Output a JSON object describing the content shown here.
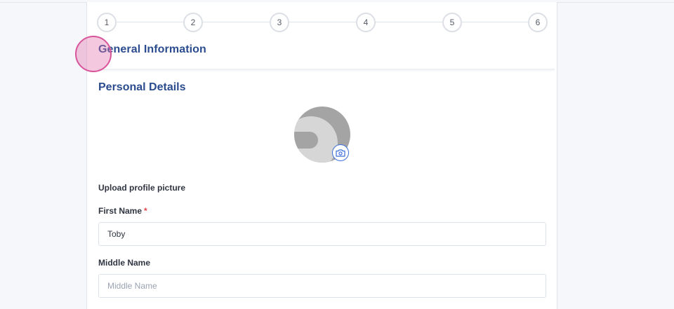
{
  "stepper": {
    "steps": [
      "1",
      "2",
      "3",
      "4",
      "5",
      "6"
    ]
  },
  "section": {
    "title": "General Information"
  },
  "subsection": {
    "title": "Personal Details"
  },
  "profile": {
    "upload_label": "Upload profile picture"
  },
  "form": {
    "first_name": {
      "label": "First Name",
      "required_mark": "*",
      "value": "Toby"
    },
    "middle_name": {
      "label": "Middle Name",
      "value": "",
      "placeholder": "Middle Name"
    }
  },
  "colors": {
    "heading": "#2b4c8e",
    "accent": "#3d6fd9",
    "required": "#e0444c",
    "cursor_highlight": "#d8559b"
  },
  "icons": {
    "avatar": "default-avatar-icon",
    "camera": "camera-icon"
  }
}
